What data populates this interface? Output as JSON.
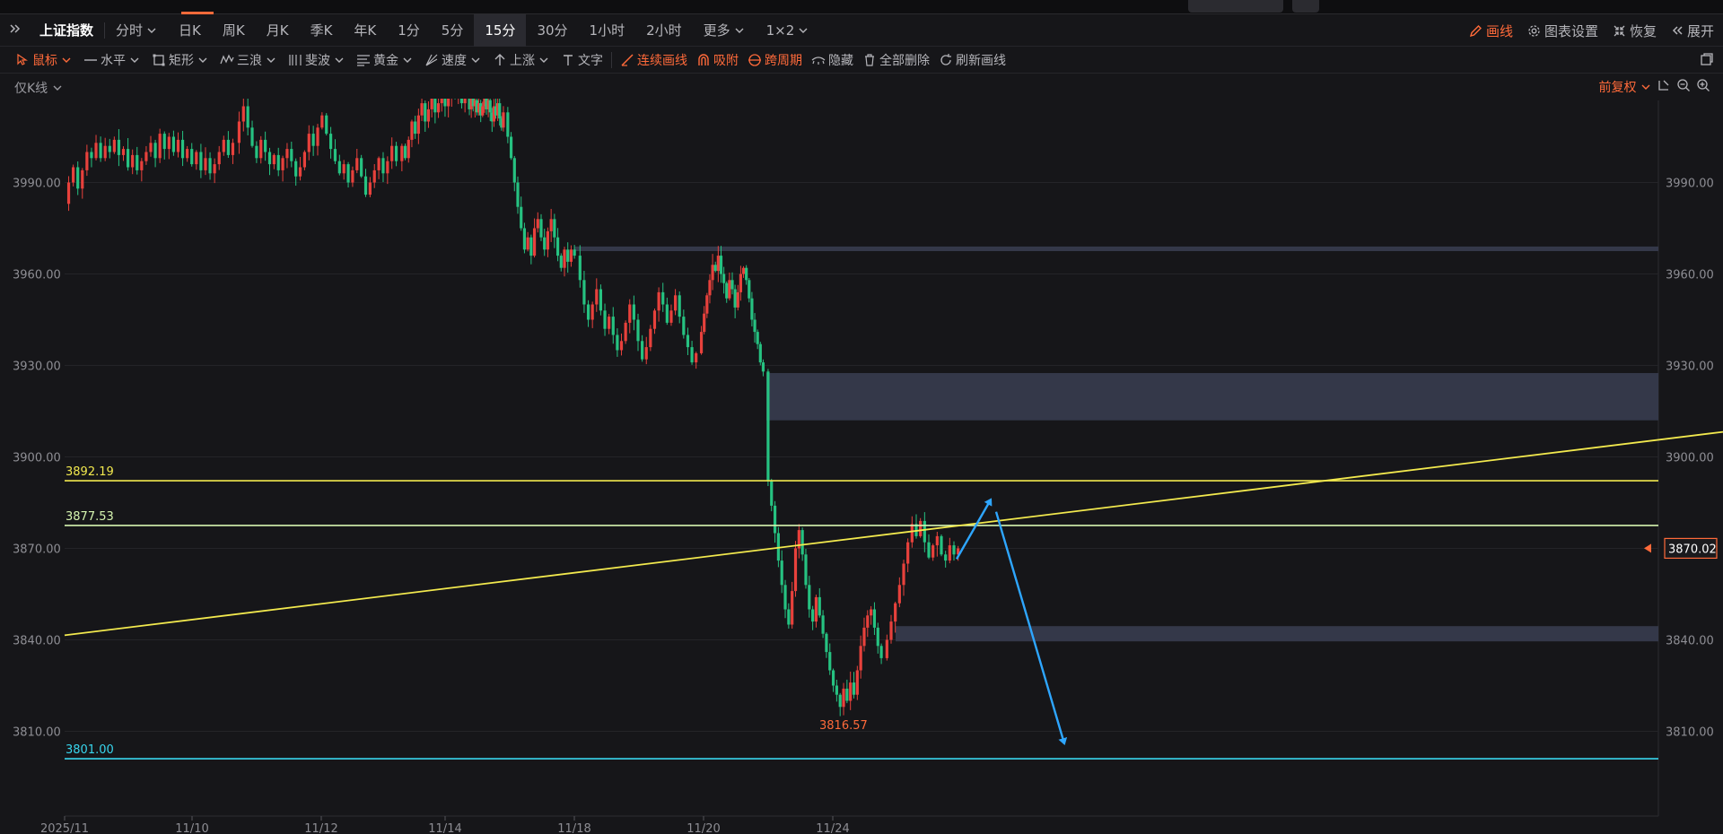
{
  "periodbar": {
    "collapse_icon": "double-chevron-right-icon",
    "symbol": "上证指数",
    "periods": [
      {
        "label": "分时",
        "dropdown": true
      },
      {
        "label": "日K"
      },
      {
        "label": "周K"
      },
      {
        "label": "月K"
      },
      {
        "label": "季K"
      },
      {
        "label": "年K"
      },
      {
        "label": "1分"
      },
      {
        "label": "5分"
      },
      {
        "label": "15分",
        "active": true
      },
      {
        "label": "30分"
      },
      {
        "label": "1小时"
      },
      {
        "label": "2小时"
      },
      {
        "label": "更多",
        "dropdown": true
      },
      {
        "label": "1×2",
        "dropdown": true
      }
    ],
    "draw_label": "画线",
    "chart_settings_label": "图表设置",
    "restore_label": "恢复",
    "expand_label": "展开"
  },
  "drawbar": {
    "tools": [
      {
        "name": "cursor",
        "label": "鼠标",
        "orange": true,
        "dropdown": true
      },
      {
        "name": "horizontal",
        "label": "水平",
        "dropdown": true
      },
      {
        "name": "rectangle",
        "label": "矩形",
        "dropdown": true
      },
      {
        "name": "three-wave",
        "label": "三浪",
        "dropdown": true
      },
      {
        "name": "fibonacci",
        "label": "斐波",
        "dropdown": true
      },
      {
        "name": "golden",
        "label": "黄金",
        "dropdown": true
      },
      {
        "name": "speed",
        "label": "速度",
        "dropdown": true
      },
      {
        "name": "rise",
        "label": "上涨",
        "dropdown": true
      },
      {
        "name": "text",
        "label": "文字"
      }
    ],
    "actions": [
      {
        "name": "continuous-draw",
        "label": "连续画线",
        "orange": true
      },
      {
        "name": "snap",
        "label": "吸附",
        "orange": true
      },
      {
        "name": "cross-period",
        "label": "跨周期",
        "orange": true
      },
      {
        "name": "hide",
        "label": "隐藏"
      },
      {
        "name": "delete-all",
        "label": "全部删除"
      },
      {
        "name": "refresh-lines",
        "label": "刷新画线"
      }
    ]
  },
  "indicator": {
    "left_label": "仅K线",
    "adjust_label": "前复权"
  },
  "colors": {
    "up": "#e8413c",
    "down": "#26c281",
    "yellow_line": "#f2e94e",
    "light_line": "#d6f5b0",
    "cyan_line": "#38d6ee",
    "arrow": "#2ea6ff",
    "zone": "#363a4c",
    "last_price": "#ff6a3a"
  },
  "chart_data": {
    "type": "candlestick",
    "title": "",
    "xlabel": "",
    "ylabel": "",
    "y_ticks": [
      "3990.00",
      "3960.00",
      "3930.00",
      "3900.00",
      "3870.00",
      "3840.00",
      "3810.00"
    ],
    "x_ticks": [
      "2025/11",
      "11/10",
      "11/12",
      "11/14",
      "11/18",
      "11/20",
      "11/24"
    ],
    "last_price": "3870.02",
    "low_label": "3816.57",
    "horizontal_lines": [
      {
        "label": "3892.19",
        "value": 3892.19,
        "color": "#f2e94e"
      },
      {
        "label": "3877.53",
        "value": 3877.53,
        "color": "#d6f5b0"
      },
      {
        "label": "3801.00",
        "value": 3801.0,
        "color": "#38d6ee"
      }
    ],
    "trend_line": {
      "from_value": 3841.5,
      "to_value": 3908.2
    },
    "zones": [
      {
        "low": 3967.5,
        "high": 3969.0
      },
      {
        "low": 3912.0,
        "high": 3927.5
      },
      {
        "low": 3839.5,
        "high": 3844.5
      }
    ],
    "projection": {
      "points": [
        3866.5,
        3886.0,
        3806.0
      ]
    },
    "path": [
      [
        3983,
        3990,
        3995,
        3988,
        3994,
        4000,
        3998,
        4003,
        3998,
        4002,
        4000,
        4004,
        3999,
        4001,
        3995,
        3999,
        3994,
        3997,
        4000,
        4003,
        3998,
        4006,
        4001,
        4005,
        4000,
        4004,
        3998,
        4001,
        3996,
        4000,
        3994,
        3998,
        3993,
        3996,
        4000,
        4004,
        3999,
        4003
      ],
      [
        4003,
        4010,
        4015,
        4008,
        4002,
        3998,
        4004,
        4000,
        3996,
        3999,
        3994,
        3998,
        4001,
        3997,
        3992,
        3995,
        4000,
        4006,
        4002,
        4008,
        4012,
        4006,
        4001,
        3997,
        3993,
        3996,
        3990,
        3994,
        3998,
        3992,
        3986,
        3990,
        3994,
        3998,
        3993,
        3997,
        4002,
        3997
      ],
      [
        3997,
        4002,
        3998,
        4004,
        4010,
        4006,
        4012,
        4016,
        4010,
        4014,
        4018,
        4013,
        4016,
        4020,
        4015,
        4018,
        4022,
        4018,
        4020,
        4016,
        4019
      ],
      [
        4019,
        4014,
        4018,
        4015,
        4017,
        4013,
        4016,
        4012,
        4015,
        4018,
        4014,
        4017,
        4013,
        4010,
        4015,
        4012,
        4016,
        4011,
        4008,
        4013
      ],
      [
        4013,
        4005,
        3998,
        3990,
        3982,
        3975,
        3968,
        3972,
        3966,
        3975,
        3978,
        3972,
        3968,
        3974,
        3978,
        3972,
        3966,
        3962,
        3968,
        3964,
        3968,
        3966
      ],
      [
        3966,
        3958,
        3950,
        3945,
        3950,
        3955,
        3948,
        3942,
        3946,
        3940,
        3935,
        3938,
        3944,
        3950,
        3945,
        3938,
        3932,
        3936,
        3942,
        3948,
        3954,
        3950,
        3944,
        3948,
        3953,
        3946,
        3940,
        3936,
        3931,
        3934
      ],
      [
        3934,
        3941,
        3947,
        3953,
        3958,
        3963,
        3961,
        3966,
        3960,
        3957,
        3952,
        3958,
        3955,
        3949,
        3954,
        3960,
        3962,
        3958,
        3952,
        3945,
        3941,
        3937,
        3931,
        3928
      ],
      [
        3928,
        3892,
        3884,
        3875,
        3866,
        3858,
        3850,
        3845,
        3856,
        3870,
        3876,
        3868,
        3858,
        3850,
        3846,
        3854,
        3848,
        3842,
        3836,
        3830,
        3825,
        3822,
        3818,
        3824,
        3820,
        3826,
        3822,
        3830,
        3838,
        3844,
        3848,
        3850,
        3844,
        3838,
        3834
      ],
      [
        3834,
        3840,
        3846,
        3852,
        3858,
        3865,
        3872,
        3878,
        3874,
        3879,
        3872,
        3867,
        3871,
        3874,
        3868,
        3866,
        3871,
        3868,
        3870
      ]
    ]
  }
}
